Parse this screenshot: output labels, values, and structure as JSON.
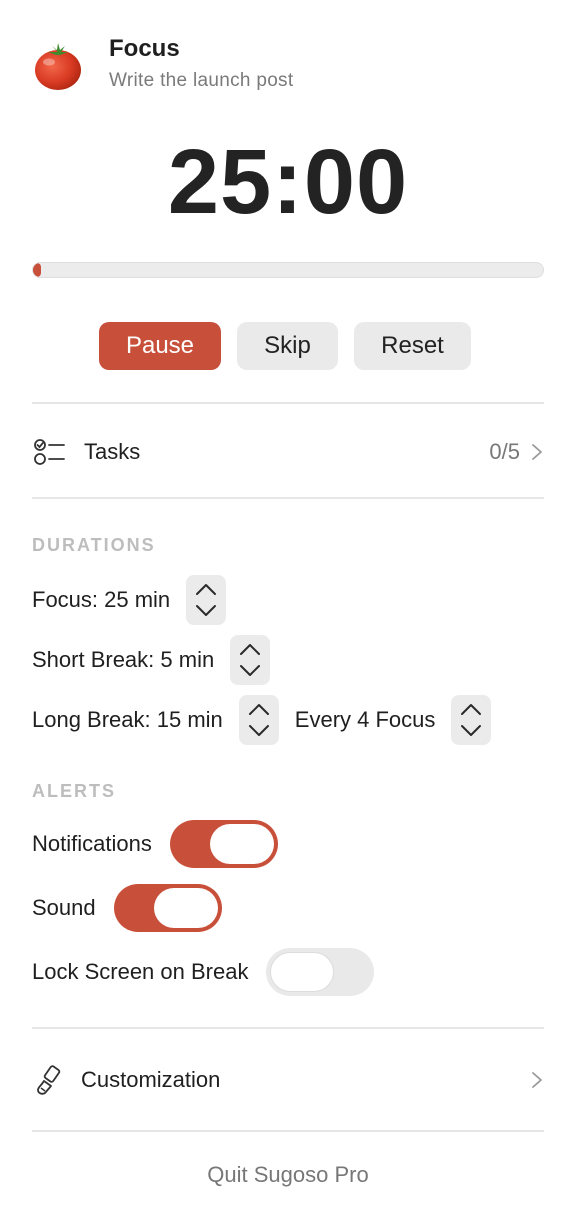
{
  "header": {
    "icon": "tomato-icon",
    "title": "Focus",
    "subtitle": "Write the launch post"
  },
  "timer": {
    "display": "25:00",
    "progress_fraction": 0.01
  },
  "controls": {
    "pause_label": "Pause",
    "skip_label": "Skip",
    "reset_label": "Reset"
  },
  "tasks": {
    "icon": "checklist-icon",
    "label": "Tasks",
    "count": "0/5"
  },
  "durations": {
    "heading": "DURATIONS",
    "focus_label": "Focus: 25 min",
    "short_break_label": "Short Break: 5 min",
    "long_break_label": "Long Break: 15 min",
    "long_break_every_label": "Every 4 Focus"
  },
  "alerts": {
    "heading": "ALERTS",
    "items": [
      {
        "label": "Notifications",
        "on": true
      },
      {
        "label": "Sound",
        "on": true
      },
      {
        "label": "Lock Screen on Break",
        "on": false
      }
    ]
  },
  "customization": {
    "icon": "paintbrush-icon",
    "label": "Customization"
  },
  "footer": {
    "quit_label": "Quit Sugoso Pro"
  },
  "colors": {
    "accent": "#c8503b",
    "neutral_button": "#eaeaea",
    "muted_text": "#777777",
    "section_heading": "#bdbdbd"
  }
}
